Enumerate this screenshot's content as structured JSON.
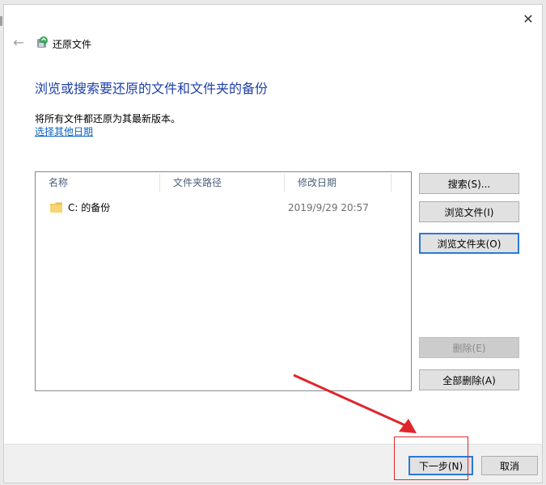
{
  "window": {
    "title": "还原文件",
    "close_label": "✕",
    "back_label": "←"
  },
  "main": {
    "heading": "浏览或搜索要还原的文件和文件夹的备份",
    "description": "将所有文件都还原为其最新版本。",
    "choose_date_link": "选择其他日期"
  },
  "file_list": {
    "columns": [
      "名称",
      "文件夹路径",
      "修改日期"
    ],
    "rows": [
      {
        "name": "C: 的备份",
        "folder_path": "",
        "modified": "2019/9/29 20:57"
      }
    ]
  },
  "side_buttons": {
    "search": "搜索(S)...",
    "browse_files": "浏览文件(I)",
    "browse_folders": "浏览文件夹(O)",
    "delete": "删除(E)",
    "delete_all": "全部删除(A)"
  },
  "footer": {
    "next": "下一步(N)",
    "cancel": "取消"
  },
  "colors": {
    "heading": "#1c3fa8",
    "link": "#0b63c3",
    "focus_border": "#2b79d4",
    "annotation": "#e0252b"
  }
}
